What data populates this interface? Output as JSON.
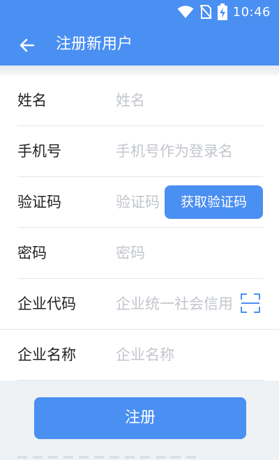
{
  "status_bar": {
    "time": "10:46",
    "icons": [
      "wifi-icon",
      "no-sim-icon",
      "battery-charging-icon"
    ]
  },
  "app_bar": {
    "title": "注册新用户",
    "back_icon": "arrow-left-icon"
  },
  "form": {
    "fields": [
      {
        "label": "姓名",
        "placeholder": "姓名"
      },
      {
        "label": "手机号",
        "placeholder": "手机号作为登录名"
      },
      {
        "label": "验证码",
        "placeholder": "验证码"
      },
      {
        "label": "密码",
        "placeholder": "密码"
      },
      {
        "label": "企业代码",
        "placeholder": "企业统一社会信用代码"
      },
      {
        "label": "企业名称",
        "placeholder": "企业名称"
      }
    ],
    "get_code_button": "获取验证码",
    "scan_icon": "scan-icon"
  },
  "submit_button": "注册",
  "colors": {
    "primary": "#4a8ff2",
    "background": "#eef2f5",
    "placeholder": "#c2c6cc"
  }
}
